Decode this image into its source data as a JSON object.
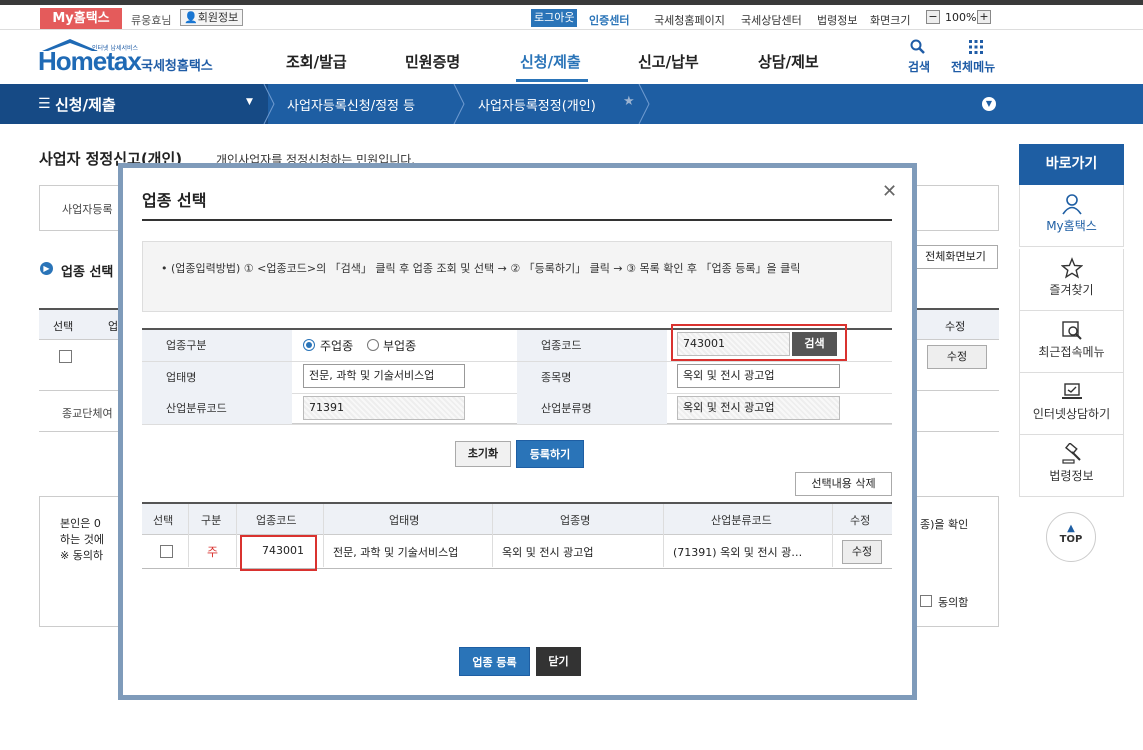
{
  "topbar": {
    "my_home": "My홈택스",
    "greeting": "류웅효님",
    "member_info": "회원정보",
    "logout": "로그아웃",
    "cert_center": "인증센터",
    "links": [
      "국세청홈페이지",
      "국세상담센터",
      "법령정보",
      "화면크기"
    ],
    "zoom": "100%"
  },
  "header": {
    "logo": "Hometax",
    "logo_sub": "국세청홈택스",
    "logo_tiny": "인터넷 납세서비스",
    "menu": [
      "조회/발급",
      "민원증명",
      "신청/제출",
      "신고/납부",
      "상담/제보"
    ],
    "search": "검색",
    "all_menu": "전체메뉴"
  },
  "nav": {
    "main": "신청/제출",
    "crumbs": [
      "사업자등록신청/정정 등",
      "사업자등록정정(개인)"
    ]
  },
  "page": {
    "title": "사업자 정정신고(개인)",
    "desc": "개인사업자를 정정신청하는 민원입니다.",
    "box1_label": "사업자등록",
    "section_title": "업종 선택",
    "full_view": "전체화면보기",
    "bg_col_select": "선택",
    "bg_col_up": "업",
    "bg_col_modify": "수정",
    "bg_modify_btn": "수정",
    "religious": "종교단체여",
    "agree_text": "본인은 0\n하는 것에\n※ 동의하",
    "agree_text_right": "종)을 확인",
    "agree_label": "동의함"
  },
  "quick": {
    "title": "바로가기",
    "items": [
      "My홈택스",
      "즐겨찾기",
      "최근접속메뉴",
      "인터넷상담하기",
      "법령정보"
    ],
    "top": "TOP"
  },
  "modal": {
    "title": "업종 선택",
    "info": "(업종입력방법) ① <업종코드>의 「검색」 클릭 후 업종 조회 및 선택 → ② 「등록하기」 클릭 → ③ 목록 확인 후 「업종 등록」을 클릭",
    "form": {
      "type_label": "업종구분",
      "radio_main": "주업종",
      "radio_sub": "부업종",
      "code_label": "업종코드",
      "code_value": "743001",
      "search_btn": "검색",
      "biz_type_label": "업태명",
      "biz_type_value": "전문, 과학 및 기술서비스업",
      "item_label": "종목명",
      "item_value": "옥외 및 전시 광고업",
      "ind_code_label": "산업분류코드",
      "ind_code_value": "71391",
      "ind_name_label": "산업분류명",
      "ind_name_value": "옥외 및 전시 광고업"
    },
    "btn_reset": "초기화",
    "btn_add": "등록하기",
    "btn_delete_selected": "선택내용 삭제",
    "table": {
      "headers": [
        "선택",
        "구분",
        "업종코드",
        "업태명",
        "업종명",
        "산업분류코드",
        "수정"
      ],
      "rows": [
        {
          "kind": "주",
          "code": "743001",
          "biz_type": "전문, 과학 및 기술서비스업",
          "item": "옥외 및 전시 광고업",
          "ind": "(71391) 옥외 및 전시 광…",
          "modify": "수정"
        }
      ]
    },
    "btn_register": "업종 등록",
    "btn_close": "닫기"
  },
  "colors": {
    "primary": "#2a74b8",
    "nav": "#1e5ea3",
    "highlight": "#d9322f",
    "myhome": "#e45b5b"
  }
}
